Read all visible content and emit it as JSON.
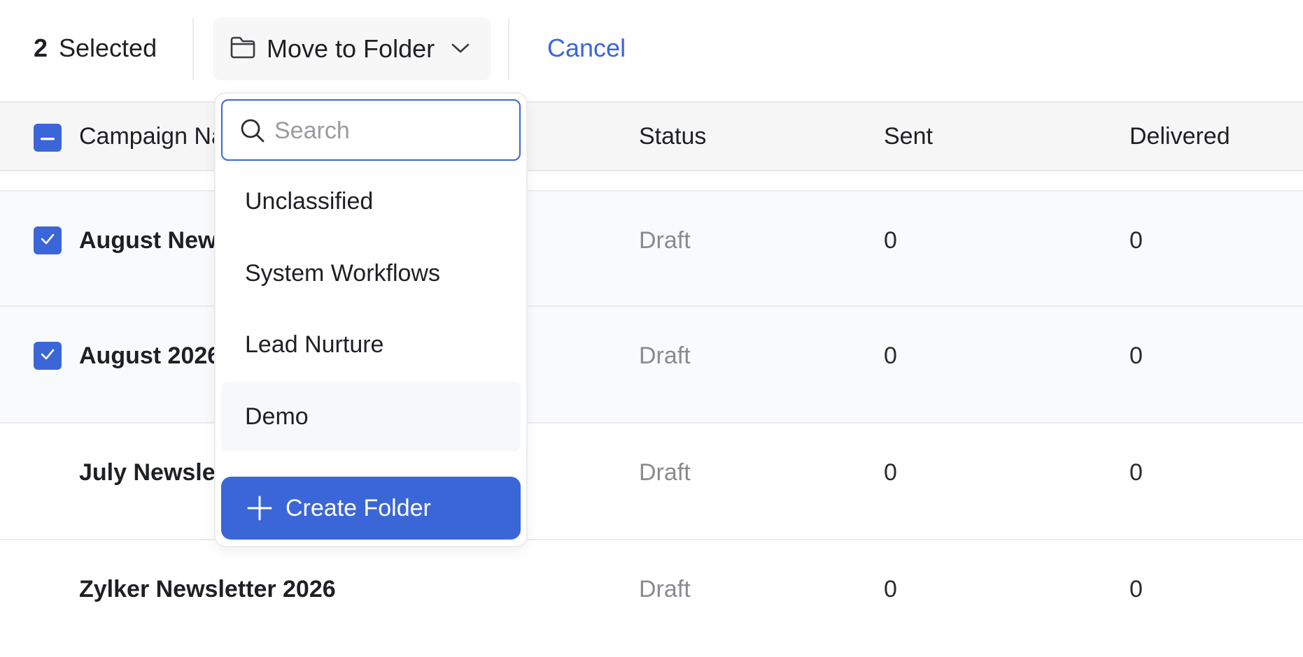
{
  "toolbar": {
    "selected_count": "2",
    "selected_label": "Selected",
    "move_label": "Move to Folder",
    "cancel_label": "Cancel"
  },
  "table": {
    "columns": [
      "Campaign Name",
      "Status",
      "Sent",
      "Delivered"
    ],
    "rows": [
      {
        "name": "August Newsletter",
        "status": "Draft",
        "sent": "0",
        "delivered": "0",
        "selected": true
      },
      {
        "name": "August 2026",
        "status": "Draft",
        "sent": "0",
        "delivered": "0",
        "selected": true
      },
      {
        "name": "July Newsletter",
        "status": "Draft",
        "sent": "0",
        "delivered": "0",
        "selected": false
      },
      {
        "name": "Zylker Newsletter 2026",
        "status": "Draft",
        "sent": "0",
        "delivered": "0",
        "selected": false
      }
    ]
  },
  "dropdown": {
    "search_placeholder": "Search",
    "search_value": "",
    "options": [
      "Unclassified",
      "System Workflows",
      "Lead Nurture",
      "Demo"
    ],
    "highlighted_option": "Demo",
    "create_label": "Create Folder"
  },
  "colors": {
    "accent": "#3b66d8",
    "header_bg": "#f6f6f6",
    "muted_text": "#8a8b90"
  },
  "icons": [
    "folder-icon",
    "chevron-down-icon",
    "search-icon",
    "plus-icon",
    "checkbox-indeterminate-icon",
    "checkbox-checked-icon"
  ]
}
